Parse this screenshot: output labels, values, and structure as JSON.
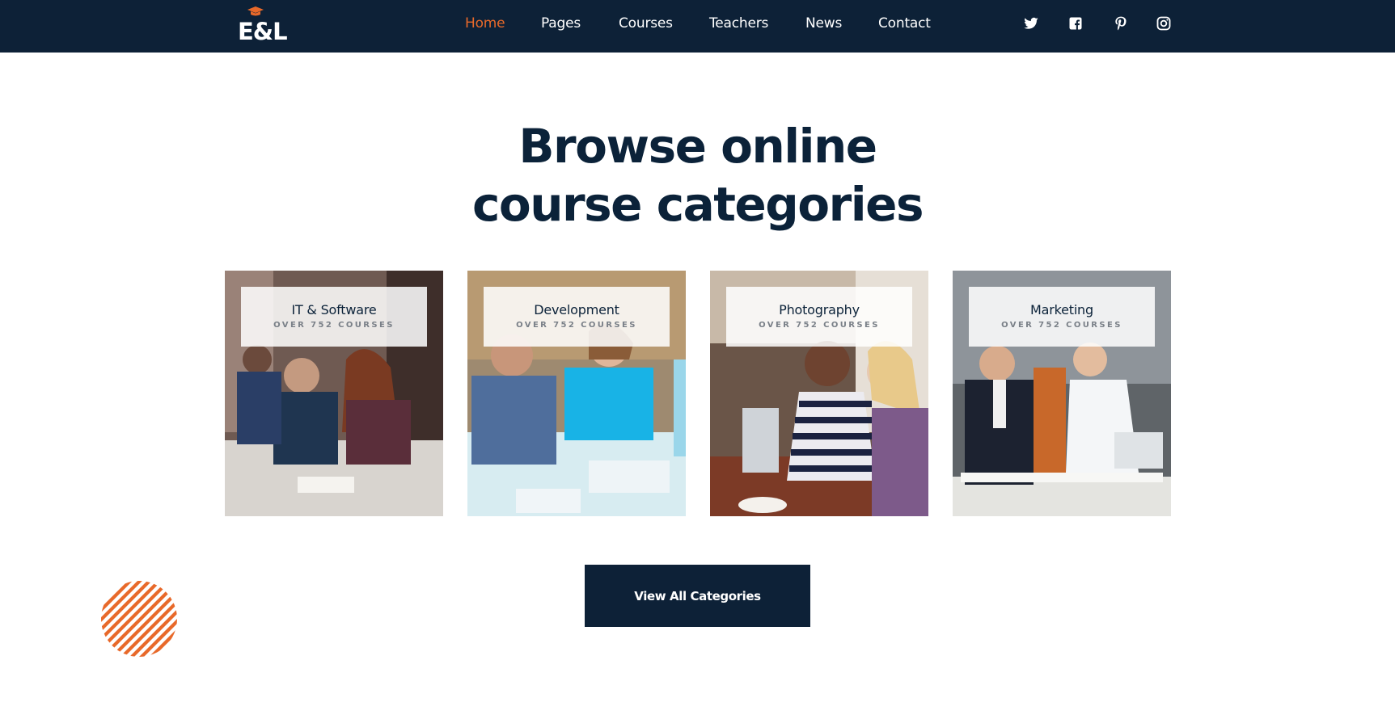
{
  "brand": {
    "logo_text": "E&L",
    "logo_icon": "graduation-cap-icon"
  },
  "nav": {
    "items": [
      {
        "label": "Home",
        "active": true
      },
      {
        "label": "Pages",
        "active": false
      },
      {
        "label": "Courses",
        "active": false
      },
      {
        "label": "Teachers",
        "active": false
      },
      {
        "label": "News",
        "active": false
      },
      {
        "label": "Contact",
        "active": false
      }
    ]
  },
  "social": [
    "twitter-icon",
    "facebook-icon",
    "pinterest-icon",
    "instagram-icon"
  ],
  "heading": {
    "line1": "Browse online",
    "line2": "course categories"
  },
  "categories": [
    {
      "title": "IT & Software",
      "subtitle": "OVER 752 COURSES"
    },
    {
      "title": "Development",
      "subtitle": "OVER 752 COURSES"
    },
    {
      "title": "Photography",
      "subtitle": "OVER 752 COURSES"
    },
    {
      "title": "Marketing",
      "subtitle": "OVER 752 COURSES"
    }
  ],
  "cta": {
    "label": "View All Categories"
  },
  "colors": {
    "navy": "#0d2137",
    "accent": "#e8692a",
    "white": "#ffffff"
  }
}
